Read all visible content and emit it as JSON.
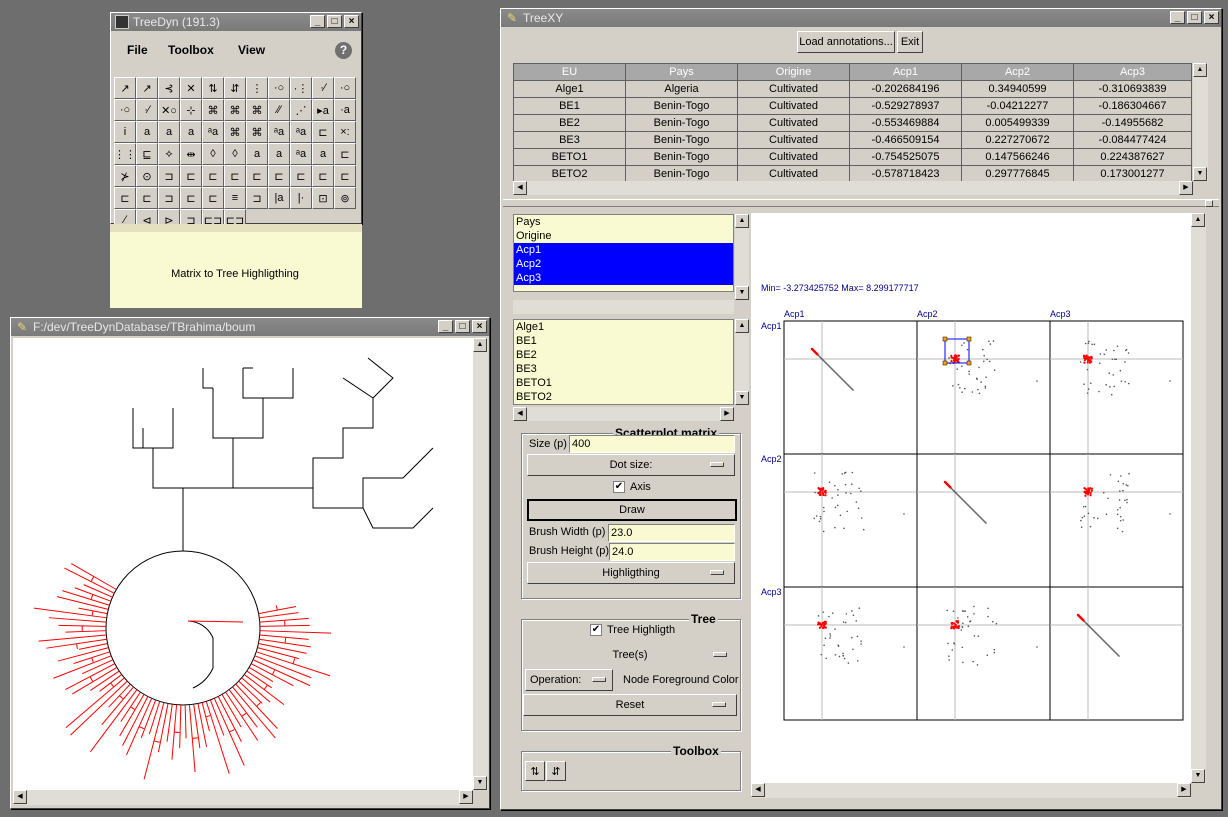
{
  "treedyn_win": {
    "title": "TreeDyn (191.3)",
    "menu": [
      "File",
      "Toolbox",
      "View"
    ],
    "help_label": "?",
    "status": "Matrix to Tree Highligthing",
    "tools": [
      "↗",
      "↗",
      "⊰",
      "✕",
      "⇅",
      "⇵",
      "⋮",
      "·○",
      "·⋮",
      "·∕",
      "·○",
      "·○",
      "·∕",
      "✕○",
      "⊹",
      "⌘",
      "⌘",
      "⌘",
      "∕∕",
      "⋰",
      "▸a",
      "·a",
      "i",
      "a",
      "a",
      "a",
      "ᵃa",
      "⌘",
      "⌘",
      "ᵃa",
      "ᵃa",
      "⊏",
      "×:",
      "⋮⋮",
      "⊑",
      "⟡",
      "⇹",
      "◊",
      "◊",
      "a",
      "a",
      "ᵃa",
      "a",
      "⊏",
      "⊁",
      "⊙",
      "⊐",
      "⊏",
      "⊏",
      "⊏",
      "⊏",
      "⊏",
      "⊏",
      "⊏",
      "⊏",
      "⊏",
      "⊏",
      "⊐",
      "⊏",
      "⊏",
      "≡",
      "⊐",
      "|a",
      "|·",
      "⊡",
      "⊚",
      "∕",
      "⊲",
      "⊳",
      "⊐",
      "⊏⊐",
      "⊏⊐"
    ]
  },
  "tree_win": {
    "title": "F:/dev/TreeDynDatabase/TBrahima/boum"
  },
  "treexy_win": {
    "title": "TreeXY",
    "load_button": "Load annotations...",
    "exit_button": "Exit",
    "table": {
      "headers": [
        "EU",
        "Pays",
        "Origine",
        "Acp1",
        "Acp2",
        "Acp3"
      ],
      "rows": [
        [
          "Alge1",
          "Algeria",
          "Cultivated",
          "-0.202684196",
          "0.34940599",
          "-0.310693839"
        ],
        [
          "BE1",
          "Benin-Togo",
          "Cultivated",
          "-0.529278937",
          "-0.04212277",
          "-0.186304667"
        ],
        [
          "BE2",
          "Benin-Togo",
          "Cultivated",
          "-0.553469884",
          "0.005499339",
          "-0.14955682"
        ],
        [
          "BE3",
          "Benin-Togo",
          "Cultivated",
          "-0.466509154",
          "0.227270672",
          "-0.084477424"
        ],
        [
          "BETO1",
          "Benin-Togo",
          "Cultivated",
          "-0.754525075",
          "0.147566246",
          "0.224387627"
        ],
        [
          "BETO2",
          "Benin-Togo",
          "Cultivated",
          "-0.578718423",
          "0.297776845",
          "0.173001277"
        ]
      ]
    },
    "var_list": [
      {
        "label": "Pays",
        "selected": false
      },
      {
        "label": "Origine",
        "selected": false
      },
      {
        "label": "Acp1",
        "selected": true
      },
      {
        "label": "Acp2",
        "selected": true
      },
      {
        "label": "Acp3",
        "selected": true
      }
    ],
    "eu_list": [
      "Alge1",
      "BE1",
      "BE2",
      "BE3",
      "BETO1",
      "BETO2"
    ],
    "scatter_group": {
      "title": "Scatterplot matrix",
      "size_label": "Size (p)",
      "size_value": "400",
      "dot_size_label": "Dot size:",
      "axis_label": "Axis",
      "axis_checked": true,
      "draw_label": "Draw",
      "brush_width_label": "Brush Width (p)",
      "brush_width_value": "23.0",
      "brush_height_label": "Brush Height (p)",
      "brush_height_value": "24.0",
      "highlight_label": "Highligthing"
    },
    "tree_group": {
      "title": "Tree",
      "highlight_label": "Tree Highligth",
      "highlight_checked": true,
      "trees_label": "Tree(s)",
      "operation_label": "Operation:",
      "operation_value": "Node Foreground Color",
      "reset_label": "Reset"
    },
    "toolbox_group": {
      "title": "Toolbox"
    },
    "plot": {
      "minmax": "Min= -3.273425752 Max= 8.299177717",
      "vars": [
        "Acp1",
        "Acp2",
        "Acp3"
      ],
      "highlight_color": "#ff0000",
      "label_color": "#00008b"
    }
  }
}
